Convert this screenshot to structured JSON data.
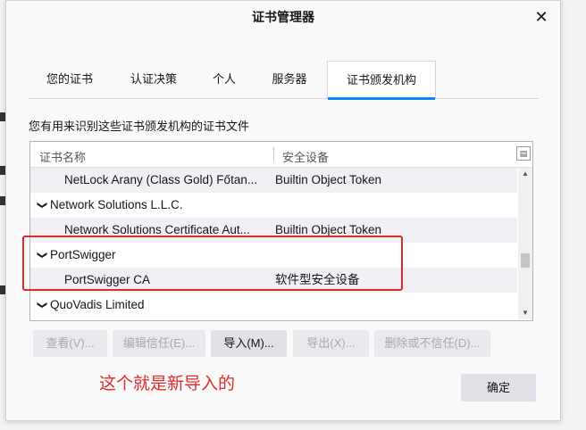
{
  "dialog": {
    "title": "证书管理器",
    "close_glyph": "✕"
  },
  "tabs": [
    {
      "label": "您的证书",
      "active": false
    },
    {
      "label": "认证决策",
      "active": false
    },
    {
      "label": "个人",
      "active": false
    },
    {
      "label": "服务器",
      "active": false
    },
    {
      "label": "证书颁发机构",
      "active": true
    }
  ],
  "description": "您有用来识别这些证书颁发机构的证书文件",
  "tree": {
    "columns": {
      "name": "证书名称",
      "device": "安全设备"
    },
    "rows": [
      {
        "type": "child",
        "name": "NetLock Arany (Class Gold) Főtan...",
        "device": "Builtin Object Token"
      },
      {
        "type": "group",
        "name": "Network Solutions L.L.C.",
        "device": ""
      },
      {
        "type": "child",
        "name": "Network Solutions Certificate Aut...",
        "device": "Builtin Object Token"
      },
      {
        "type": "group",
        "name": "PortSwigger",
        "device": ""
      },
      {
        "type": "child",
        "name": "PortSwigger CA",
        "device": "软件型安全设备"
      },
      {
        "type": "group",
        "name": "QuoVadis Limited",
        "device": ""
      }
    ]
  },
  "buttons": {
    "view": "查看(V)...",
    "edit_trust": "编辑信任(E)...",
    "import": "导入(M)...",
    "export": "导出(X)...",
    "delete": "删除或不信任(D)...",
    "ok": "确定"
  },
  "annotation": "这个就是新导入的",
  "accent": "#0a84ff",
  "annotation_color": "#e02b2b"
}
